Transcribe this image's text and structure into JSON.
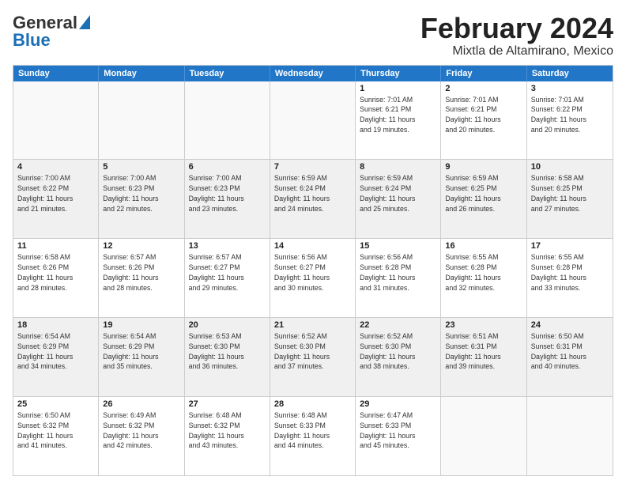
{
  "logo": {
    "line1": "General",
    "line2": "Blue"
  },
  "title": "February 2024",
  "subtitle": "Mixtla de Altamirano, Mexico",
  "header_days": [
    "Sunday",
    "Monday",
    "Tuesday",
    "Wednesday",
    "Thursday",
    "Friday",
    "Saturday"
  ],
  "weeks": [
    [
      {
        "day": "",
        "info": ""
      },
      {
        "day": "",
        "info": ""
      },
      {
        "day": "",
        "info": ""
      },
      {
        "day": "",
        "info": ""
      },
      {
        "day": "1",
        "info": "Sunrise: 7:01 AM\nSunset: 6:21 PM\nDaylight: 11 hours\nand 19 minutes."
      },
      {
        "day": "2",
        "info": "Sunrise: 7:01 AM\nSunset: 6:21 PM\nDaylight: 11 hours\nand 20 minutes."
      },
      {
        "day": "3",
        "info": "Sunrise: 7:01 AM\nSunset: 6:22 PM\nDaylight: 11 hours\nand 20 minutes."
      }
    ],
    [
      {
        "day": "4",
        "info": "Sunrise: 7:00 AM\nSunset: 6:22 PM\nDaylight: 11 hours\nand 21 minutes."
      },
      {
        "day": "5",
        "info": "Sunrise: 7:00 AM\nSunset: 6:23 PM\nDaylight: 11 hours\nand 22 minutes."
      },
      {
        "day": "6",
        "info": "Sunrise: 7:00 AM\nSunset: 6:23 PM\nDaylight: 11 hours\nand 23 minutes."
      },
      {
        "day": "7",
        "info": "Sunrise: 6:59 AM\nSunset: 6:24 PM\nDaylight: 11 hours\nand 24 minutes."
      },
      {
        "day": "8",
        "info": "Sunrise: 6:59 AM\nSunset: 6:24 PM\nDaylight: 11 hours\nand 25 minutes."
      },
      {
        "day": "9",
        "info": "Sunrise: 6:59 AM\nSunset: 6:25 PM\nDaylight: 11 hours\nand 26 minutes."
      },
      {
        "day": "10",
        "info": "Sunrise: 6:58 AM\nSunset: 6:25 PM\nDaylight: 11 hours\nand 27 minutes."
      }
    ],
    [
      {
        "day": "11",
        "info": "Sunrise: 6:58 AM\nSunset: 6:26 PM\nDaylight: 11 hours\nand 28 minutes."
      },
      {
        "day": "12",
        "info": "Sunrise: 6:57 AM\nSunset: 6:26 PM\nDaylight: 11 hours\nand 28 minutes."
      },
      {
        "day": "13",
        "info": "Sunrise: 6:57 AM\nSunset: 6:27 PM\nDaylight: 11 hours\nand 29 minutes."
      },
      {
        "day": "14",
        "info": "Sunrise: 6:56 AM\nSunset: 6:27 PM\nDaylight: 11 hours\nand 30 minutes."
      },
      {
        "day": "15",
        "info": "Sunrise: 6:56 AM\nSunset: 6:28 PM\nDaylight: 11 hours\nand 31 minutes."
      },
      {
        "day": "16",
        "info": "Sunrise: 6:55 AM\nSunset: 6:28 PM\nDaylight: 11 hours\nand 32 minutes."
      },
      {
        "day": "17",
        "info": "Sunrise: 6:55 AM\nSunset: 6:28 PM\nDaylight: 11 hours\nand 33 minutes."
      }
    ],
    [
      {
        "day": "18",
        "info": "Sunrise: 6:54 AM\nSunset: 6:29 PM\nDaylight: 11 hours\nand 34 minutes."
      },
      {
        "day": "19",
        "info": "Sunrise: 6:54 AM\nSunset: 6:29 PM\nDaylight: 11 hours\nand 35 minutes."
      },
      {
        "day": "20",
        "info": "Sunrise: 6:53 AM\nSunset: 6:30 PM\nDaylight: 11 hours\nand 36 minutes."
      },
      {
        "day": "21",
        "info": "Sunrise: 6:52 AM\nSunset: 6:30 PM\nDaylight: 11 hours\nand 37 minutes."
      },
      {
        "day": "22",
        "info": "Sunrise: 6:52 AM\nSunset: 6:30 PM\nDaylight: 11 hours\nand 38 minutes."
      },
      {
        "day": "23",
        "info": "Sunrise: 6:51 AM\nSunset: 6:31 PM\nDaylight: 11 hours\nand 39 minutes."
      },
      {
        "day": "24",
        "info": "Sunrise: 6:50 AM\nSunset: 6:31 PM\nDaylight: 11 hours\nand 40 minutes."
      }
    ],
    [
      {
        "day": "25",
        "info": "Sunrise: 6:50 AM\nSunset: 6:32 PM\nDaylight: 11 hours\nand 41 minutes."
      },
      {
        "day": "26",
        "info": "Sunrise: 6:49 AM\nSunset: 6:32 PM\nDaylight: 11 hours\nand 42 minutes."
      },
      {
        "day": "27",
        "info": "Sunrise: 6:48 AM\nSunset: 6:32 PM\nDaylight: 11 hours\nand 43 minutes."
      },
      {
        "day": "28",
        "info": "Sunrise: 6:48 AM\nSunset: 6:33 PM\nDaylight: 11 hours\nand 44 minutes."
      },
      {
        "day": "29",
        "info": "Sunrise: 6:47 AM\nSunset: 6:33 PM\nDaylight: 11 hours\nand 45 minutes."
      },
      {
        "day": "",
        "info": ""
      },
      {
        "day": "",
        "info": ""
      }
    ]
  ]
}
